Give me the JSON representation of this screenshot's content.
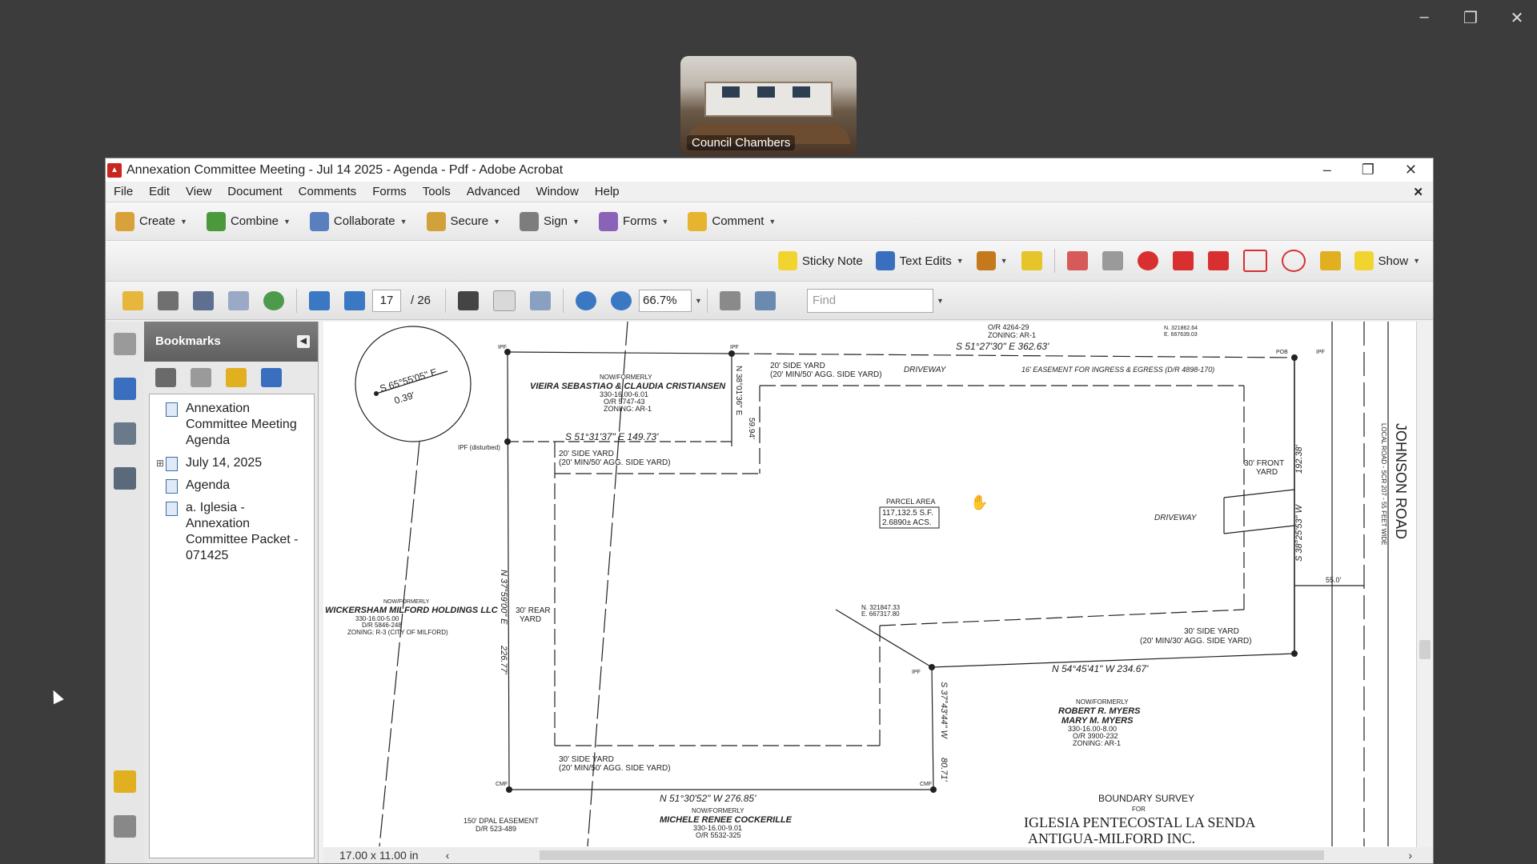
{
  "outer": {
    "min": "–",
    "restore": "❐",
    "close": "✕"
  },
  "video": {
    "caption": "Council Chambers"
  },
  "window": {
    "title": "Annexation Committee Meeting - Jul 14 2025 - Agenda - Pdf - Adobe Acrobat",
    "min": "–",
    "restore": "❐",
    "close": "✕"
  },
  "menu": [
    "File",
    "Edit",
    "View",
    "Document",
    "Comments",
    "Forms",
    "Tools",
    "Advanced",
    "Window",
    "Help"
  ],
  "toolbar1": [
    {
      "label": "Create",
      "color": "#d9a13a"
    },
    {
      "label": "Combine",
      "color": "#4a9a3b"
    },
    {
      "label": "Collaborate",
      "color": "#5a7fbf"
    },
    {
      "label": "Secure",
      "color": "#d1a23c"
    },
    {
      "label": "Sign",
      "color": "#7d7d7d"
    },
    {
      "label": "Forms",
      "color": "#8a63b8"
    },
    {
      "label": "Comment",
      "color": "#e6b42e"
    }
  ],
  "toolbar2": {
    "sticky": "Sticky Note",
    "textedits": "Text Edits",
    "show": "Show"
  },
  "nav": {
    "page": "17",
    "total": "/ 26",
    "zoom": "66.7%",
    "find_placeholder": "Find"
  },
  "bookmarks": {
    "title": "Bookmarks",
    "items": [
      {
        "label": "Annexation Committee Meeting Agenda",
        "expand": ""
      },
      {
        "label": "July 14, 2025",
        "expand": "⊞"
      },
      {
        "label": "Agenda",
        "expand": ""
      },
      {
        "label": "a. Iglesia - Annexation Committee Packet - 071425",
        "expand": ""
      }
    ]
  },
  "survey": {
    "owner_top": "VIEIRA SEBASTIAO & CLAUDIA CRISTIANSEN",
    "owner_top_prefix": "NOW/FORMERLY",
    "owner_top_ref": "330-16.00-6.01",
    "owner_top_or": "O/R 5747-43",
    "owner_top_zone": "ZONING: AR-1",
    "or_top": "O/R 4264-29",
    "zoning_top": "ZONING: AR-1",
    "bearing_top_right": "S 51°27'30\" E   362.63'",
    "bearing_mid": "S 51°31'37\" E   149.73'",
    "circle_bearing": "S 65°55'05\" E",
    "circle_dist": "0.39'",
    "side_yard_1": "20' SIDE YARD",
    "side_yard_1b": "(20' MIN/50' AGG. SIDE YARD)",
    "driveway_top": "DRIVEWAY",
    "easement": "16' EASEMENT FOR INGRESS & EGRESS (D/R 4898-170)",
    "side_yard_2": "20' SIDE YARD",
    "side_yard_2b": "(20' MIN/50' AGG. SIDE YARD)",
    "dist_59": "59.94'",
    "bearing_vert_1": "N 38°01'36\" E",
    "parcel_title": "PARCEL AREA",
    "parcel_sf": "117,132.5 S.F.",
    "parcel_ac": "2.6890± ACS.",
    "front_yard": "30' FRONT",
    "front_yard_b": "YARD",
    "driveway_right": "DRIVEWAY",
    "bearing_right_vert": "S 38°25'53\" W",
    "dist_right": "192.38'",
    "road": "JOHNSON ROAD",
    "road_sub": "LOCAL ROAD - SCR 207 - 55 FEET WIDE",
    "road_width": "55.0'",
    "owner_left_prefix": "NOW/FORMERLY",
    "owner_left": "WICKERSHAM MILFORD HOLDINGS LLC",
    "owner_left_ref": "330-16.00-5.00",
    "owner_left_or": "D/R 5846-248",
    "owner_left_zone": "ZONING: R-3 (CITY OF MILFORD)",
    "rear_yard": "30' REAR",
    "rear_yard_b": "YARD",
    "bearing_left_vert": "N 37°59'00\" E",
    "dist_left": "226.77'",
    "coord_n": "N. 321847.33",
    "coord_e": "E. 667317.80",
    "side_yard_3": "30' SIDE YARD",
    "side_yard_3b": "(20' MIN/30' AGG. SIDE YARD)",
    "bearing_n54": "N 54°45'41\" W   234.67'",
    "bearing_s37": "S 37°43'44\" W",
    "dist_807": "80.71'",
    "owner_right_prefix": "NOW/FORMERLY",
    "owner_right_1": "ROBERT R. MYERS",
    "owner_right_2": "MARY M. MYERS",
    "owner_right_ref": "330-16.00-8.00",
    "owner_right_or": "O/R 3900-232",
    "owner_right_zone": "ZONING: AR-1",
    "side_yard_4": "30' SIDE YARD",
    "side_yard_4b": "(20' MIN/50' AGG. SIDE YARD)",
    "bearing_bottom": "N 51°30'52\" W   276.85'",
    "owner_bottom_prefix": "NOW/FORMERLY",
    "owner_bottom": "MICHELE RENEE COCKERILLE",
    "owner_bottom_ref": "330-16.00-9.01",
    "owner_bottom_or": "O/R 5532-325",
    "easement_bottom": "150' DPAL EASEMENT",
    "easement_bottom_b": "D/R 523-489",
    "survey_title": "BOUNDARY SURVEY",
    "survey_for": "FOR",
    "survey_client_1": "IGLESIA PENTECOSTAL LA SENDA",
    "survey_client_2": "ANTIGUA-MILFORD INC.",
    "ipf": "IPF",
    "ipf_disturbed": "IPF (disturbed)",
    "pob": "POB",
    "cmf": "CMF",
    "coord_tr_n": "N. 321862.64",
    "coord_tr_e": "E. 667639.03"
  },
  "status": {
    "page_size": "17.00 x 11.00 in"
  }
}
